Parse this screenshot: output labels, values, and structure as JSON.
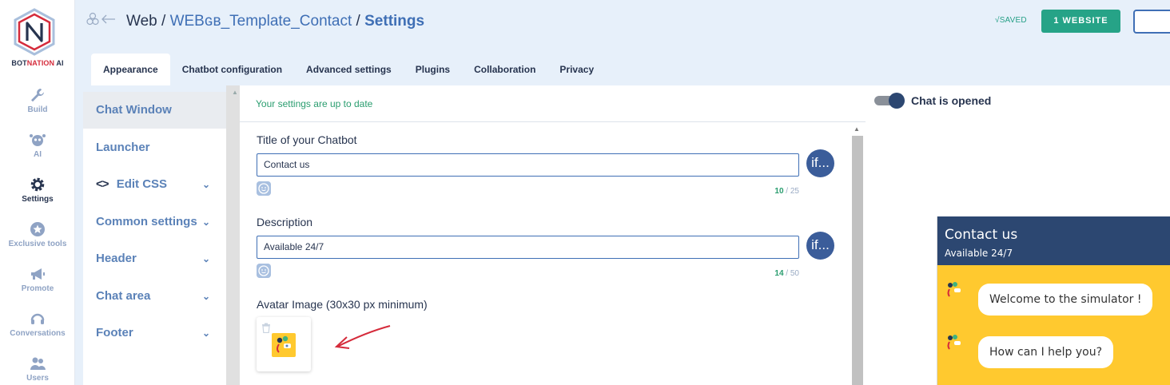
{
  "brand": {
    "name_prefix": "BOT",
    "name_red": "NATION",
    "name_suffix": " AI",
    "accent": "#d52b3b",
    "primary": "#2c4771",
    "green": "#26a387"
  },
  "rail": [
    {
      "label": "Build",
      "icon": "wrench-icon"
    },
    {
      "label": "AI",
      "icon": "robot-icon"
    },
    {
      "label": "Settings",
      "icon": "gear-icon"
    },
    {
      "label": "Exclusive tools",
      "icon": "star-icon"
    },
    {
      "label": "Promote",
      "icon": "megaphone-icon"
    },
    {
      "label": "Conversations",
      "icon": "headset-icon"
    },
    {
      "label": "Users",
      "icon": "users-icon"
    }
  ],
  "header": {
    "crumb_root": "Web",
    "crumb_sep": " / ",
    "crumb_project": "WEBɢʙ_Template_Contact",
    "crumb_page": "Settings",
    "saved": "√SAVED",
    "website_button": "1 WEBSITE"
  },
  "tabs": [
    "Appearance",
    "Chatbot configuration",
    "Advanced settings",
    "Plugins",
    "Collaboration",
    "Privacy"
  ],
  "menu": {
    "items": [
      "Chat Window",
      "Launcher",
      "Edit CSS",
      "Common settings",
      "Header",
      "Chat area",
      "Footer"
    ],
    "code_glyph": "<>",
    "chevron": "⌄"
  },
  "form": {
    "status": "Your settings are up to date",
    "title_label": "Title of your Chatbot",
    "title_value": "Contact us",
    "title_count": "10",
    "title_max": " / 25",
    "desc_label": "Description",
    "desc_value": "Available 24/7",
    "desc_count": "14",
    "desc_max": " / 50",
    "if_label": "if...",
    "avatar_label": "Avatar Image (30x30 px minimum)"
  },
  "preview": {
    "toggle_label": "Chat is opened",
    "toggle_on": true,
    "chat_title": "Contact us",
    "chat_subtitle": "Available 24/7",
    "messages": [
      "Welcome to the simulator !",
      "How can I help you?"
    ]
  }
}
